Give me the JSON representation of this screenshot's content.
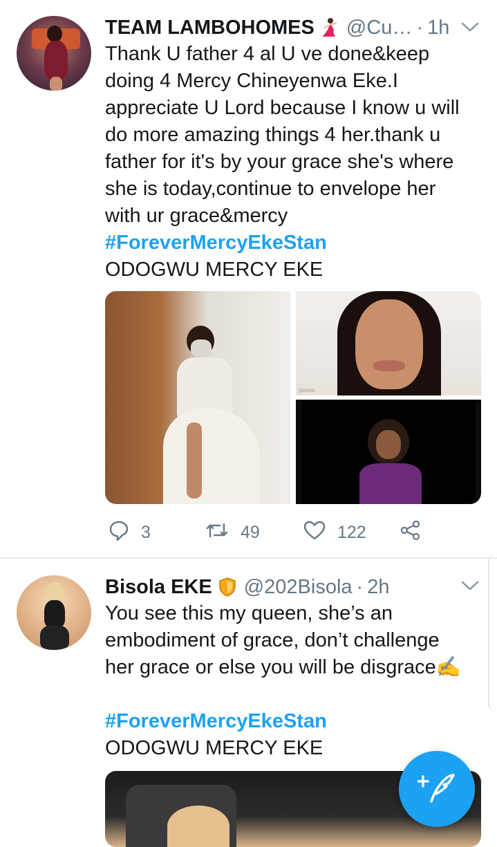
{
  "colors": {
    "link": "#1da1f2",
    "secondary": "#657786",
    "primary_text": "#14171a",
    "fab": "#1da1f2"
  },
  "tweets": [
    {
      "display_name": "TEAM LAMBOHOMES",
      "badge_icon": "dancer-emoji-icon",
      "handle": "@Cu…",
      "separator": "·",
      "time": "1h",
      "lines": [
        "Thank U father 4 al U ve done&keep",
        "doing 4 Mercy Chineyenwa Eke.I",
        "appreciate U Lord because I know u will",
        "do more amazing things 4 her.thank u",
        "father for it's by your grace she's where",
        "she is today,continue to envelope her",
        "with ur grace&mercy"
      ],
      "hashtag": "#ForeverMercyEkeStan",
      "footer_line": "ODOGWU MERCY EKE",
      "media_watermark": "piosee",
      "replies": "3",
      "retweets": "49",
      "likes": "122"
    },
    {
      "display_name": "Bisola EKE",
      "badge_icon": "shield-emoji-icon",
      "handle": "@202Bisola",
      "separator": "·",
      "time": "2h",
      "lines": [
        "You see this my queen, she’s an",
        "embodiment of grace, don’t challenge",
        "her grace or else you will be disgrace✍️"
      ],
      "hashtag": "#ForeverMercyEkeStan",
      "footer_line": "ODOGWU MERCY EKE"
    }
  ],
  "fab": {
    "icon": "compose-feather-plus-icon"
  }
}
